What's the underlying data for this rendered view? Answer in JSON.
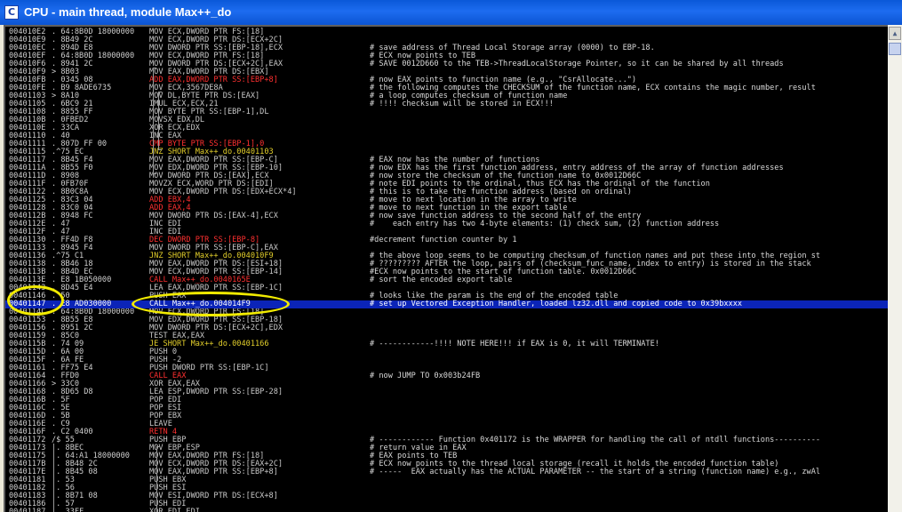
{
  "window": {
    "title": "CPU - main thread, module Max++_do",
    "icon_letter": "C"
  },
  "colors": {
    "bg": "#000000",
    "mov": "#c9c9c9",
    "op": "#ff3030",
    "jmp": "#e3cf2b",
    "grey": "#b8b8b8",
    "selection": "#0b24b8",
    "highlight": "#f2eb00"
  },
  "rows": [
    {
      "a": "004010E2",
      "h": ". 64:8B0D 18000000",
      "d": "MOV ECX,DWORD PTR FS:[18]",
      "k": "mov",
      "c": ""
    },
    {
      "a": "004010E9",
      "h": ". 8B49 2C",
      "d": "MOV ECX,DWORD PTR DS:[ECX+2C]",
      "k": "mov",
      "c": ""
    },
    {
      "a": "004010EC",
      "h": ". 894D E8",
      "d": "MOV DWORD PTR SS:[EBP-18],ECX",
      "k": "movw",
      "c": "# save address of Thread Local Storage array (0000) to EBP-18."
    },
    {
      "a": "004010EF",
      "h": ". 64:8B0D 18000000",
      "d": "MOV ECX,DWORD PTR FS:[18]",
      "k": "mov",
      "c": "# ECX now points to TEB"
    },
    {
      "a": "004010F6",
      "h": ". 8941 2C",
      "d": "MOV DWORD PTR DS:[ECX+2C],EAX",
      "k": "movw",
      "c": "# SAVE 0012D660 to the TEB->ThreadLocalStorage Pointer, so it can be shared by all threads"
    },
    {
      "a": "004010F9",
      "h": "> 8B03",
      "d": "MOV EAX,DWORD PTR DS:[EBX]",
      "k": "mov",
      "c": ""
    },
    {
      "a": "004010FB",
      "h": ". 0345 08",
      "d": "ADD EAX,DWORD PTR SS:[EBP+8]",
      "k": "op",
      "c": "# now EAX points to function name (e.g., \"CsrAllocate...\")"
    },
    {
      "a": "004010FE",
      "h": ". B9 8ADE6735",
      "d": "MOV ECX,3567DE8A",
      "k": "mov",
      "c": "# the following computes the CHECKSUM of the function name, ECX contains the magic number, result"
    },
    {
      "a": "00401103",
      "h": "> 8A10",
      "d": "MOV DL,BYTE PTR DS:[EAX]",
      "k": "mov",
      "c": "# a loop computes checksum of function name"
    },
    {
      "a": "00401105",
      "h": ". 6BC9 21",
      "d": "IMUL ECX,ECX,21",
      "k": "mov",
      "c": "# !!!! checksum will be stored in ECX!!!"
    },
    {
      "a": "00401108",
      "h": ". 8855 FF",
      "d": "MOV BYTE PTR SS:[EBP-1],DL",
      "k": "movw",
      "c": ""
    },
    {
      "a": "0040110B",
      "h": ". 0FBED2",
      "d": "MOVSX EDX,DL",
      "k": "mov",
      "c": ""
    },
    {
      "a": "0040110E",
      "h": ". 33CA",
      "d": "XOR ECX,EDX",
      "k": "mov",
      "c": ""
    },
    {
      "a": "00401110",
      "h": ". 40",
      "d": "INC EAX",
      "k": "mov",
      "c": ""
    },
    {
      "a": "00401111",
      "h": ". 807D FF 00",
      "d": "CMP BYTE PTR SS:[EBP-1],0",
      "k": "op",
      "c": ""
    },
    {
      "a": "00401115",
      "h": ".^75 EC",
      "d": "JNZ SHORT Max++_do.00401103",
      "k": "jmp",
      "c": ""
    },
    {
      "a": "00401117",
      "h": ". 8B45 F4",
      "d": "MOV EAX,DWORD PTR SS:[EBP-C]",
      "k": "movs",
      "c": "# EAX now has the number of functions"
    },
    {
      "a": "0040111A",
      "h": ". 8B55 F0",
      "d": "MOV EDX,DWORD PTR SS:[EBP-10]",
      "k": "movs",
      "c": "# now EDX has the first function address, entry address of the array of function addresses"
    },
    {
      "a": "0040111D",
      "h": ". 8908",
      "d": "MOV DWORD PTR DS:[EAX],ECX",
      "k": "mov",
      "c": "# now store the checksum of the function name to 0x0012D66C"
    },
    {
      "a": "0040111F",
      "h": ". 0FB70F",
      "d": "MOVZX ECX,WORD PTR DS:[EDI]",
      "k": "mov",
      "c": "# note EDI points to the ordinal, thus ECX has the ordinal of the function"
    },
    {
      "a": "00401122",
      "h": ". 8B0C8A",
      "d": "MOV ECX,DWORD PTR DS:[EDX+ECX*4]",
      "k": "mov",
      "c": "# this is to take the function address (based on ordinal)"
    },
    {
      "a": "00401125",
      "h": ". 83C3 04",
      "d": "ADD EBX,4",
      "k": "op",
      "c": "# move to next location in the array to write"
    },
    {
      "a": "00401128",
      "h": ". 83C0 04",
      "d": "ADD EAX,4",
      "k": "op",
      "c": "# move to next function in the export table"
    },
    {
      "a": "0040112B",
      "h": ". 8948 FC",
      "d": "MOV DWORD PTR DS:[EAX-4],ECX",
      "k": "mov",
      "c": "# now save function address to the second half of the entry"
    },
    {
      "a": "0040112E",
      "h": ". 47",
      "d": "INC EDI",
      "k": "mov",
      "c": "#    each entry has two 4-byte elements: (1) check sum, (2) function address"
    },
    {
      "a": "0040112F",
      "h": ". 47",
      "d": "INC EDI",
      "k": "mov",
      "c": ""
    },
    {
      "a": "00401130",
      "h": ". FF4D F8",
      "d": "DEC DWORD PTR SS:[EBP-8]",
      "k": "op",
      "c": "#decrement function counter by 1"
    },
    {
      "a": "00401133",
      "h": ". 8945 F4",
      "d": "MOV DWORD PTR SS:[EBP-C],EAX",
      "k": "movw",
      "c": ""
    },
    {
      "a": "00401136",
      "h": ".^75 C1",
      "d": "JNZ SHORT Max++_do.004010F9",
      "k": "jmp",
      "c": "# the above loop seems to be computing checksum of function names and put these into the region st"
    },
    {
      "a": "00401138",
      "h": ". 8B46 18",
      "d": "MOV EAX,DWORD PTR DS:[ESI+18]",
      "k": "mov",
      "c": "# ????????? AFTER the loop, pairs of (checksum_func_name, index to entry) is stored in the stack"
    },
    {
      "a": "0040113B",
      "h": ". 8B4D EC",
      "d": "MOV ECX,DWORD PTR SS:[EBP-14]",
      "k": "movs",
      "c": "#ECX now points to the start of function table. 0x0012D66C"
    },
    {
      "a": "0040113E",
      "h": ". E8 1B050000",
      "d": "CALL Max++_do.0040165E",
      "k": "op",
      "c": "# sort the encoded export table"
    },
    {
      "a": "00401143",
      "h": ". 8D45 E4",
      "d": "LEA EAX,DWORD PTR SS:[EBP-1C]",
      "k": "movs",
      "c": ""
    },
    {
      "a": "00401146",
      "h": ". 50",
      "d": "PUSH EAX",
      "k": "mov",
      "c": "# looks like the param is the end of the encoded table"
    },
    {
      "a": "00401147",
      "h": ". E8 AD030000",
      "d": "CALL Max++_do.004014F9",
      "k": "op",
      "c": "# set up Vectored Exception Handler, loaded lz32.dll and copied code to 0x39bxxxx"
    },
    {
      "a": "0040114C",
      "h": ". 64:8B0D 18000000",
      "d": "MOV ECX,DWORD PTR FS:[18]",
      "k": "mov",
      "c": ""
    },
    {
      "a": "00401153",
      "h": ". 8B55 E8",
      "d": "MOV EDX,DWORD PTR SS:[EBP-18]",
      "k": "movs",
      "c": ""
    },
    {
      "a": "00401156",
      "h": ". 8951 2C",
      "d": "MOV DWORD PTR DS:[ECX+2C],EDX",
      "k": "movw",
      "c": ""
    },
    {
      "a": "00401159",
      "h": ". 85C0",
      "d": "TEST EAX,EAX",
      "k": "mov",
      "c": ""
    },
    {
      "a": "0040115B",
      "h": ". 74 09",
      "d": "JE SHORT Max++_do.00401166",
      "k": "jmp",
      "c": "# ------------!!!! NOTE HERE!!! if EAX is 0, it will TERMINATE!"
    },
    {
      "a": "0040115D",
      "h": ". 6A 00",
      "d": "PUSH 0",
      "k": "mov",
      "c": ""
    },
    {
      "a": "0040115F",
      "h": ". 6A FE",
      "d": "PUSH -2",
      "k": "mov",
      "c": ""
    },
    {
      "a": "00401161",
      "h": ". FF75 E4",
      "d": "PUSH DWORD PTR SS:[EBP-1C]",
      "k": "movw",
      "c": ""
    },
    {
      "a": "00401164",
      "h": ". FFD0",
      "d": "CALL EAX",
      "k": "op",
      "c": "# now JUMP TO 0x003b24FB"
    },
    {
      "a": "00401166",
      "h": "> 33C0",
      "d": "XOR EAX,EAX",
      "k": "mov",
      "c": ""
    },
    {
      "a": "00401168",
      "h": ". 8D65 D8",
      "d": "LEA ESP,DWORD PTR SS:[EBP-28]",
      "k": "movs",
      "c": ""
    },
    {
      "a": "0040116B",
      "h": ". 5F",
      "d": "POP EDI",
      "k": "mov",
      "c": ""
    },
    {
      "a": "0040116C",
      "h": ". 5E",
      "d": "POP ESI",
      "k": "mov",
      "c": ""
    },
    {
      "a": "0040116D",
      "h": ". 5B",
      "d": "POP EBX",
      "k": "mov",
      "c": ""
    },
    {
      "a": "0040116E",
      "h": ". C9",
      "d": "LEAVE",
      "k": "mov",
      "c": ""
    },
    {
      "a": "0040116F",
      "h": ". C2 0400",
      "d": "RETN 4",
      "k": "op",
      "c": ""
    },
    {
      "a": "00401172",
      "h": "/$ 55",
      "d": "PUSH EBP",
      "k": "mov",
      "c": "# ------------ Function 0x401172 is the WRAPPER for handling the call of ntdll functions----------"
    },
    {
      "a": "00401173",
      "h": "|. 8BEC",
      "d": "MOV EBP,ESP",
      "k": "mov",
      "c": "# return value in EAX"
    },
    {
      "a": "00401175",
      "h": "|. 64:A1 18000000",
      "d": "MOV EAX,DWORD PTR FS:[18]",
      "k": "mov",
      "c": "# EAX points to TEB"
    },
    {
      "a": "0040117B",
      "h": "|. 8B48 2C",
      "d": "MOV ECX,DWORD PTR DS:[EAX+2C]",
      "k": "mov",
      "c": "# ECX now points to the thread local storage (recall it holds the encoded function table)"
    },
    {
      "a": "0040117E",
      "h": "|. 8B45 08",
      "d": "MOV EAX,DWORD PTR SS:[EBP+8]",
      "k": "movs",
      "c": "# -----  EAX actually has the ACTUAL PARAMETER -- the start of a string (function name) e.g., zwAl"
    },
    {
      "a": "00401181",
      "h": "|. 53",
      "d": "PUSH EBX",
      "k": "mov",
      "c": ""
    },
    {
      "a": "00401182",
      "h": "|. 56",
      "d": "PUSH ESI",
      "k": "mov",
      "c": ""
    },
    {
      "a": "00401183",
      "h": "|. 8B71 08",
      "d": "MOV ESI,DWORD PTR DS:[ECX+8]",
      "k": "mov",
      "c": ""
    },
    {
      "a": "00401186",
      "h": "|. 57",
      "d": "PUSH EDI",
      "k": "mov",
      "c": ""
    },
    {
      "a": "00401187",
      "h": "|. 33FF",
      "d": "XOR EDI,EDI",
      "k": "mov",
      "c": ""
    }
  ],
  "selected_row": 34
}
